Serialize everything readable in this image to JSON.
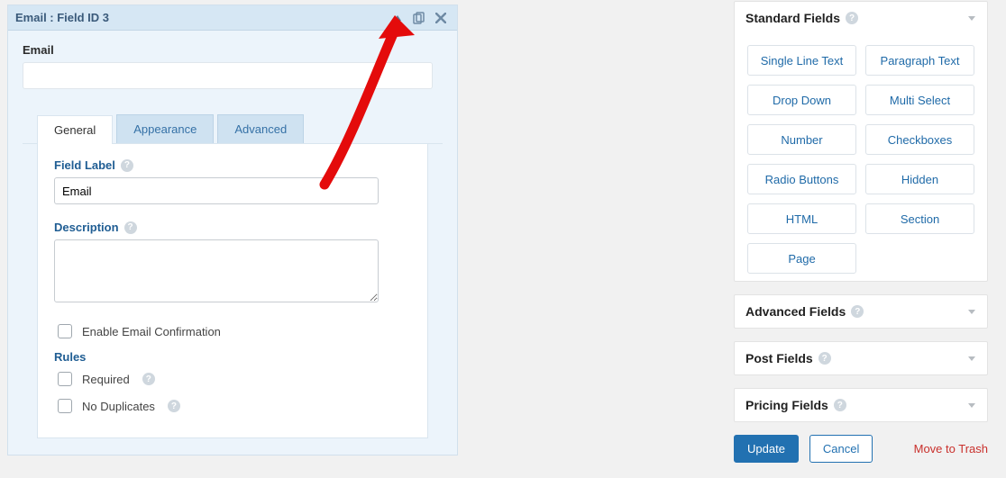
{
  "panel": {
    "title": "Email : Field ID 3",
    "preview_label": "Email",
    "tabs": {
      "general": "General",
      "appearance": "Appearance",
      "advanced": "Advanced"
    },
    "field_label": {
      "label": "Field Label",
      "value": "Email"
    },
    "description": {
      "label": "Description",
      "value": ""
    },
    "email_confirm": {
      "label": "Enable Email Confirmation",
      "checked": false
    },
    "rules": {
      "heading": "Rules",
      "required": {
        "label": "Required",
        "checked": false
      },
      "no_dup": {
        "label": "No Duplicates",
        "checked": false
      }
    }
  },
  "sidebar": {
    "sections": [
      {
        "title": "Standard Fields",
        "open": true,
        "buttons": [
          "Single Line Text",
          "Paragraph Text",
          "Drop Down",
          "Multi Select",
          "Number",
          "Checkboxes",
          "Radio Buttons",
          "Hidden",
          "HTML",
          "Section",
          "Page"
        ]
      },
      {
        "title": "Advanced Fields",
        "open": false
      },
      {
        "title": "Post Fields",
        "open": false
      },
      {
        "title": "Pricing Fields",
        "open": false
      }
    ],
    "actions": {
      "update": "Update",
      "cancel": "Cancel",
      "trash": "Move to Trash"
    }
  }
}
